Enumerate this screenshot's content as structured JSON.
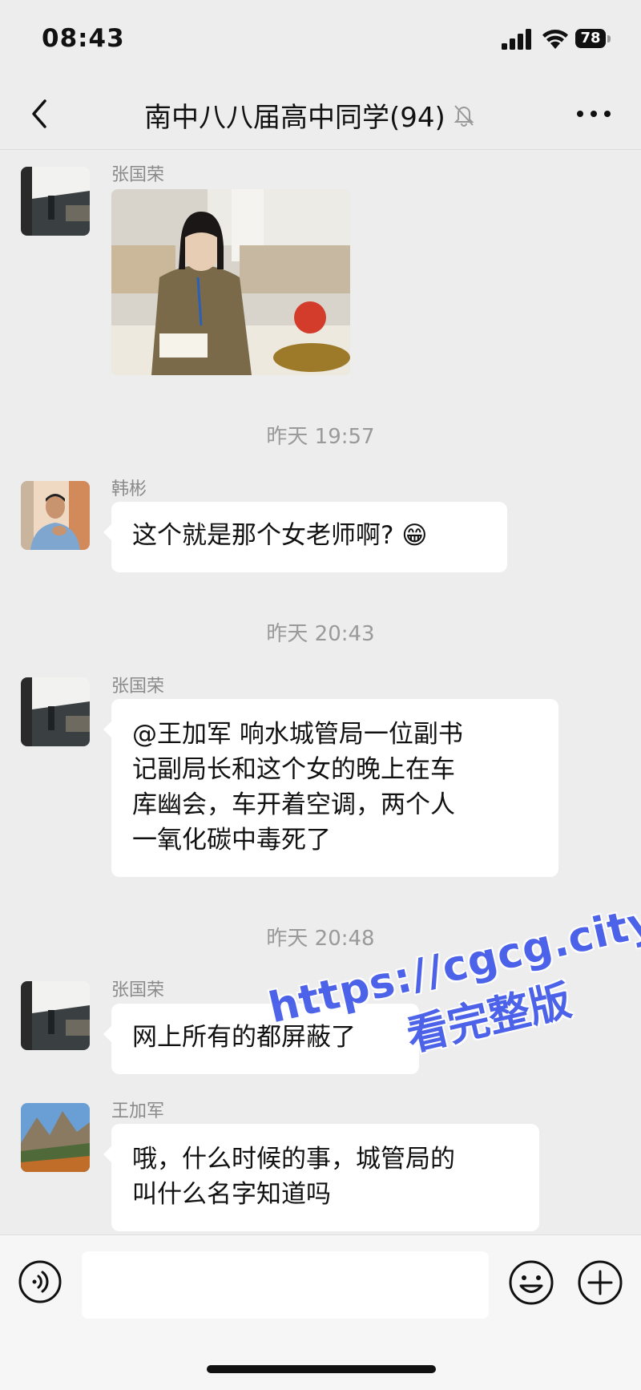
{
  "status_bar": {
    "time": "08:43",
    "battery": "78"
  },
  "nav": {
    "title": "南中八八届高中同学(94)"
  },
  "messages": [
    {
      "sender": "张国荣",
      "type": "image"
    },
    {
      "timestamp": "昨天 19:57"
    },
    {
      "sender": "韩彬",
      "text": "这个就是那个女老师啊? 😁"
    },
    {
      "timestamp": "昨天 20:43"
    },
    {
      "sender": "张国荣",
      "lines": [
        "@王加军  响水城管局一位副书",
        "记副局长和这个女的晚上在车",
        "库幽会，车开着空调，两个人",
        "一氧化碳中毒死了"
      ]
    },
    {
      "timestamp": "昨天 20:48"
    },
    {
      "sender": "张国荣",
      "text": "网上所有的都屏蔽了"
    },
    {
      "sender": "王加军",
      "lines": [
        "哦，什么时候的事，城管局的",
        "叫什么名字知道吗"
      ]
    }
  ],
  "watermark": {
    "url": "https://cgcg.city",
    "text": "看完整版"
  },
  "colors": {
    "background": "#ededed",
    "bubble": "#ffffff",
    "watermark": "#3f57e8"
  }
}
